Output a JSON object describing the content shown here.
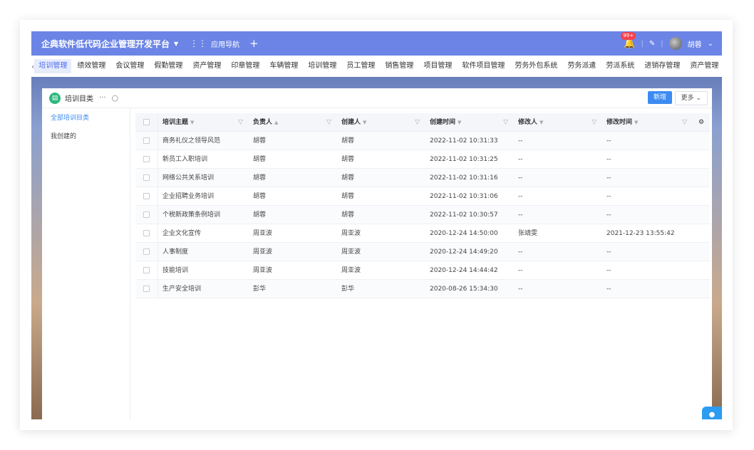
{
  "header": {
    "app_title": "企典软件低代码企业管理开发平台",
    "nav_label": "应用导航",
    "notification_count": "99+",
    "user_name": "胡蓉"
  },
  "tabs": [
    "培训管理",
    "绩效管理",
    "会议管理",
    "假勤管理",
    "资产管理",
    "印章管理",
    "车辆管理",
    "培训管理",
    "员工管理",
    "销售管理",
    "项目管理",
    "软件项目管理",
    "劳务外包系统",
    "劳务派遣",
    "劳派系统",
    "进销存管理",
    "资产管理"
  ],
  "panel": {
    "title": "培训目类",
    "new_button": "新增",
    "more_button": "更多"
  },
  "sidebar": {
    "items": [
      "全部培训目类",
      "我创建的"
    ]
  },
  "table": {
    "columns": [
      "培训主题",
      "负责人",
      "创建人",
      "创建时间",
      "修改人",
      "修改时间"
    ],
    "rows": [
      [
        "商务礼仪之领导风范",
        "胡蓉",
        "胡蓉",
        "2022-11-02 10:31:33",
        "--",
        "--"
      ],
      [
        "新员工入职培训",
        "胡蓉",
        "胡蓉",
        "2022-11-02 10:31:25",
        "--",
        "--"
      ],
      [
        "网络公共关系培训",
        "胡蓉",
        "胡蓉",
        "2022-11-02 10:31:16",
        "--",
        "--"
      ],
      [
        "企业招聘业务培训",
        "胡蓉",
        "胡蓉",
        "2022-11-02 10:31:06",
        "--",
        "--"
      ],
      [
        "个税新政策条例培训",
        "胡蓉",
        "胡蓉",
        "2022-11-02 10:30:57",
        "--",
        "--"
      ],
      [
        "企业文化宣传",
        "周亚波",
        "周亚波",
        "2020-12-24 14:50:00",
        "张靖雯",
        "2021-12-23 13:55:42"
      ],
      [
        "人事制度",
        "周亚波",
        "周亚波",
        "2020-12-24 14:49:20",
        "--",
        "--"
      ],
      [
        "技能培训",
        "周亚波",
        "周亚波",
        "2020-12-24 14:44:42",
        "--",
        "--"
      ],
      [
        "生产安全培训",
        "彭华",
        "彭华",
        "2020-08-26 15:34:30",
        "--",
        "--"
      ]
    ]
  },
  "colors": {
    "topbar": "#6b84e6",
    "accent": "#3d8bf2",
    "active_tab_bg": "#e7ecfc"
  }
}
